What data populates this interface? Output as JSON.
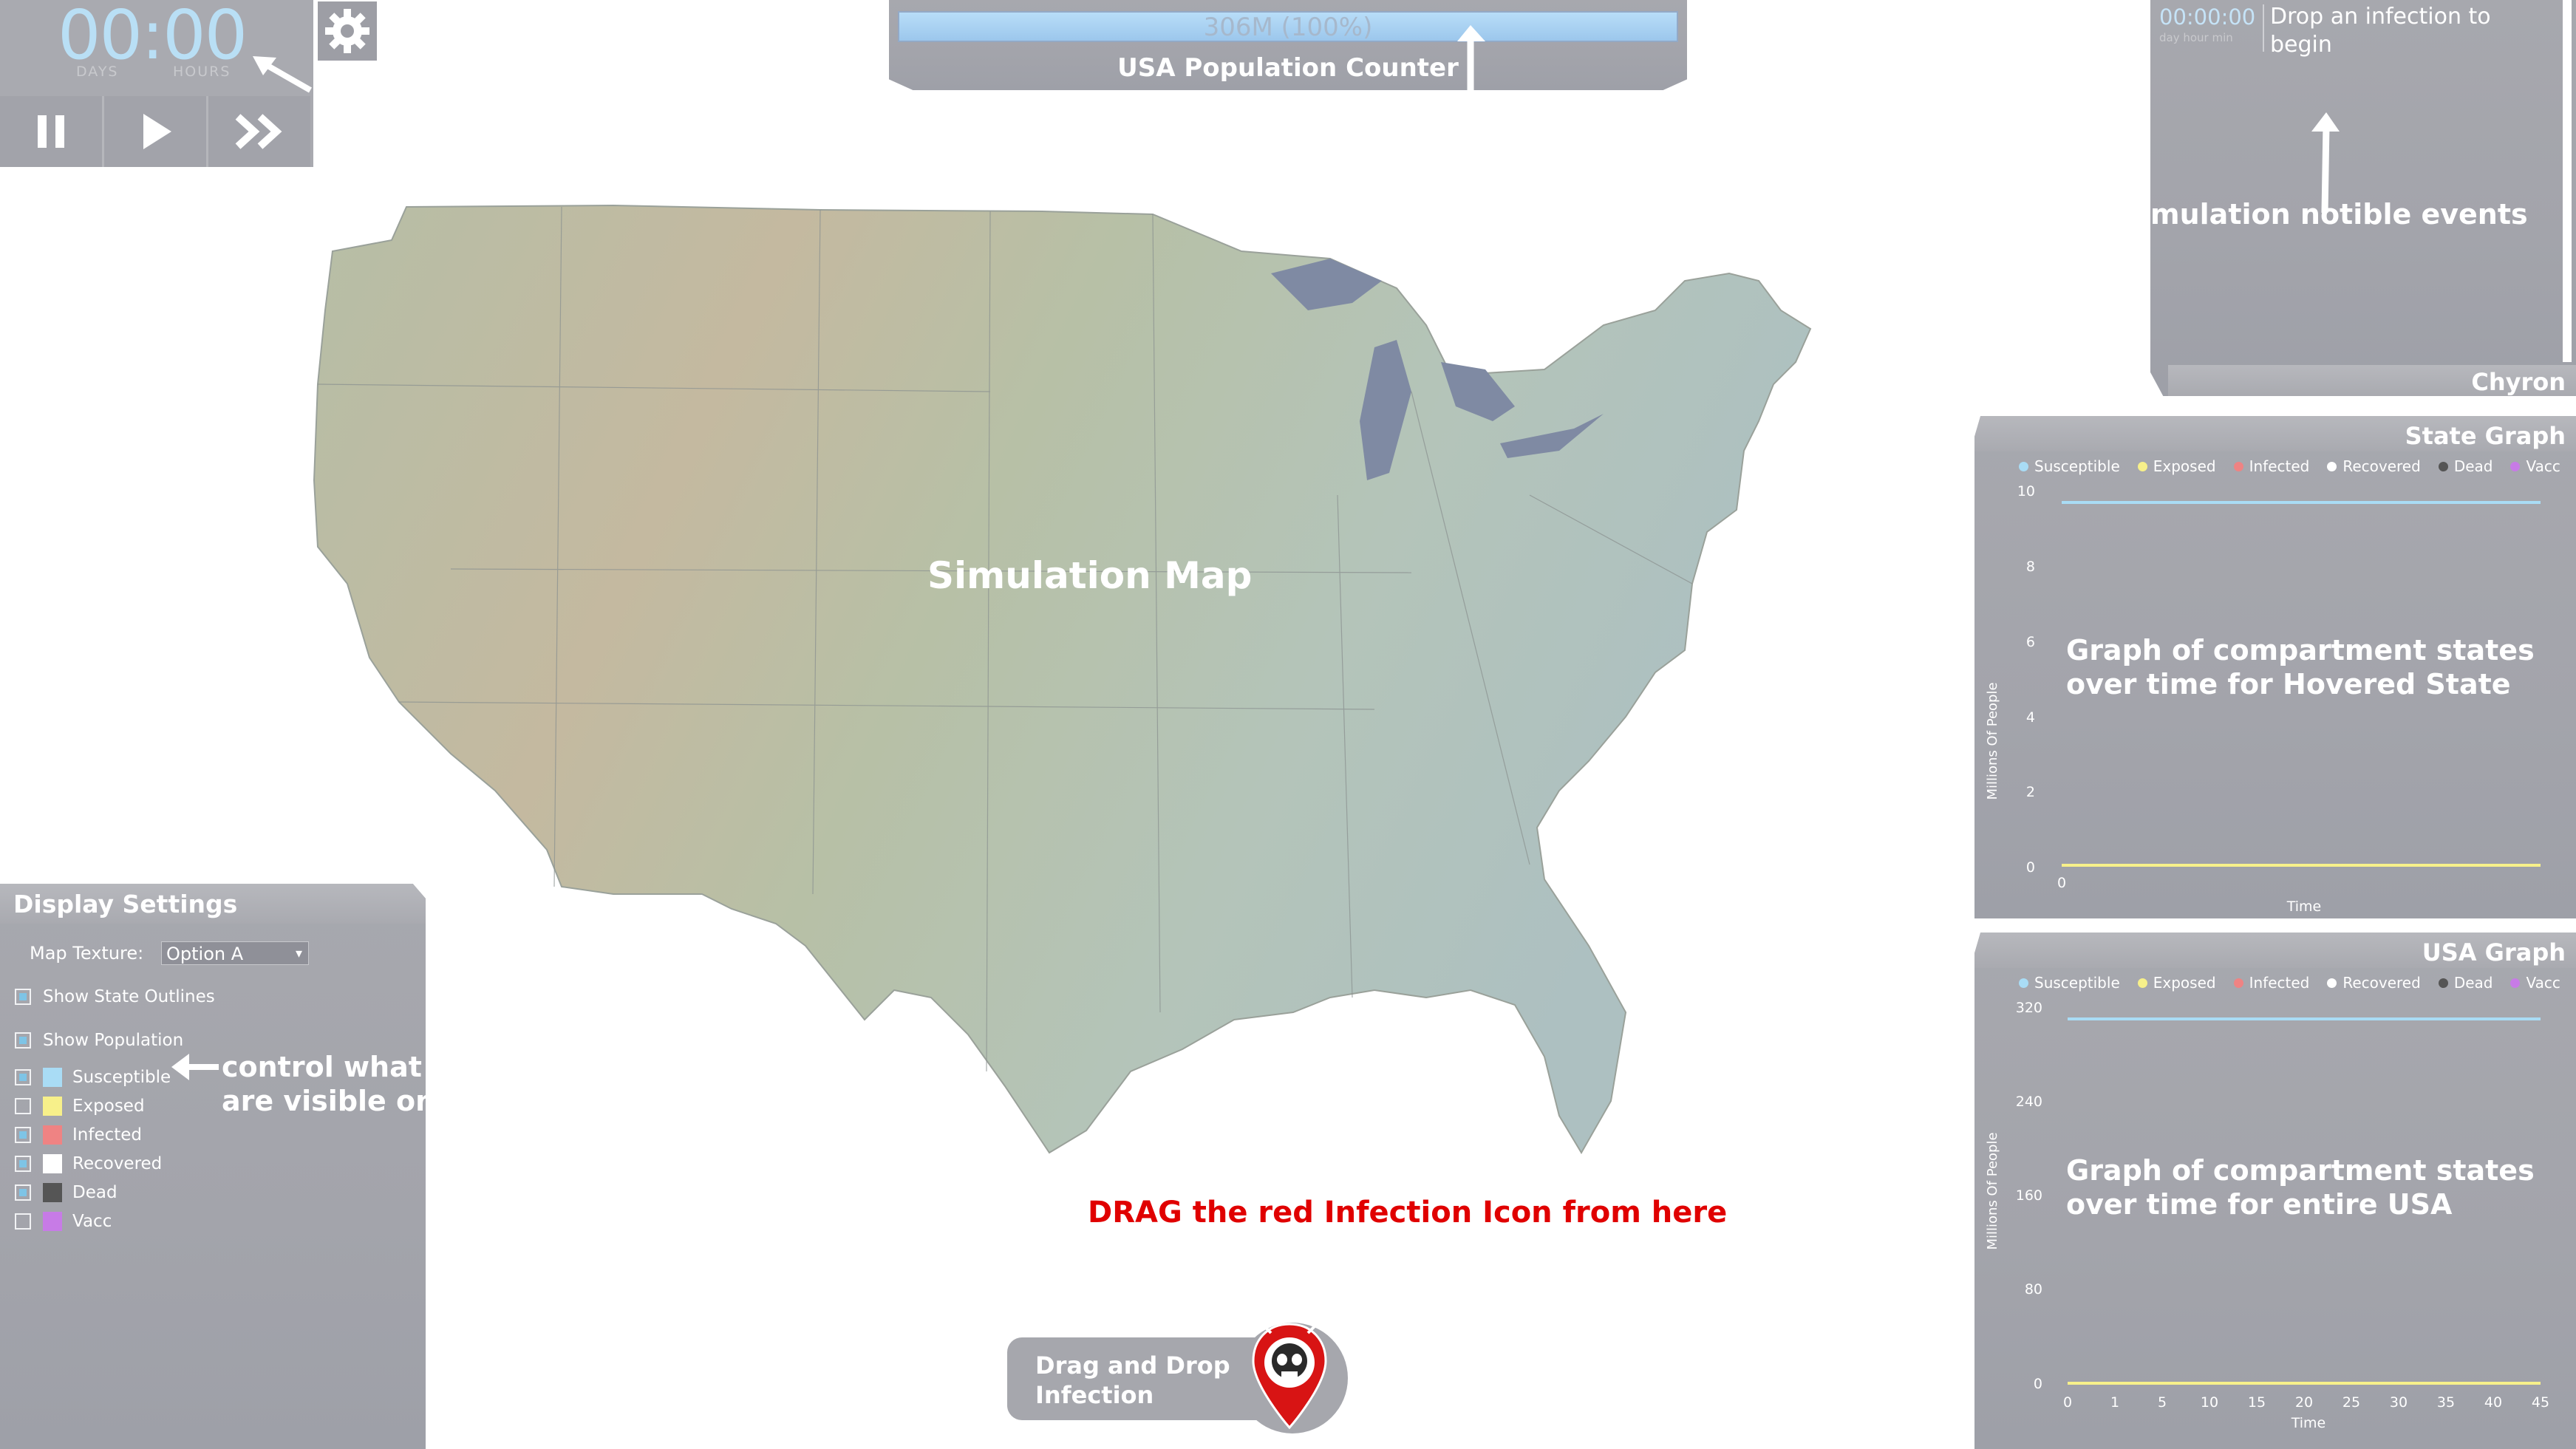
{
  "timer": {
    "value": "00:00",
    "days_label": "DAYS",
    "hours_label": "HOURS"
  },
  "controls": {
    "pause_icon": "pause-icon",
    "play_icon": "play-icon",
    "fast_forward_icon": "fast-forward-icon",
    "settings_icon": "gear-icon"
  },
  "population": {
    "bar_text": "306M (100%)",
    "fraction": 1.0,
    "title": "USA Population Counter"
  },
  "chyron": {
    "time": "00:00:00",
    "time_sub": "day hour min",
    "message": "Drop an infection to begin",
    "title": "Chyron"
  },
  "map": {
    "label": "Simulation Map"
  },
  "state_graph": {
    "title": "State Graph",
    "legend": [
      "Susceptible",
      "Exposed",
      "Infected",
      "Recovered",
      "Dead",
      "Vacc"
    ],
    "ylabel": "Millions Of People",
    "xlabel": "Time",
    "yticks": [
      "10",
      "8",
      "6",
      "4",
      "2",
      "0"
    ],
    "xticks": [
      "0"
    ]
  },
  "usa_graph": {
    "title": "USA Graph",
    "legend": [
      "Susceptible",
      "Exposed",
      "Infected",
      "Recovered",
      "Dead",
      "Vacc"
    ],
    "ylabel": "Millions Of People",
    "xlabel": "Time",
    "yticks": [
      "320",
      "240",
      "160",
      "80",
      "0"
    ],
    "xticks": [
      "0",
      "1",
      "5",
      "10",
      "15",
      "20",
      "25",
      "30",
      "35",
      "40",
      "45"
    ]
  },
  "display_settings": {
    "title": "Display Settings",
    "texture_label": "Map Texture:",
    "texture_value": "Option A",
    "show_outlines": "Show State Outlines",
    "show_population": "Show Population",
    "compartments": [
      {
        "label": "Susceptible",
        "checked": true,
        "color": "#a9dcf5"
      },
      {
        "label": "Exposed",
        "checked": false,
        "color": "#f7f08a"
      },
      {
        "label": "Infected",
        "checked": true,
        "color": "#ef8383"
      },
      {
        "label": "Recovered",
        "checked": true,
        "color": "#ffffff"
      },
      {
        "label": "Dead",
        "checked": true,
        "color": "#555555"
      },
      {
        "label": "Vacc",
        "checked": false,
        "color": "#c77be6"
      }
    ]
  },
  "drag": {
    "label_line1": "Drag and Drop",
    "label_line2": "Infection"
  },
  "annotations": {
    "notable_events": "mulation notible events",
    "control_visible_1": "control what",
    "control_visible_2": "are visible on",
    "state_graph_1": "Graph of compartment states",
    "state_graph_2": "over time for Hovered State",
    "usa_graph_1": "Graph of compartment states",
    "usa_graph_2": "over time for entire USA",
    "drag_hint": "DRAG the red Infection Icon from here"
  },
  "colors": {
    "susceptible": "#a9dcf5",
    "exposed": "#f7f08a",
    "infected": "#ef8383",
    "recovered": "#ffffff",
    "dead": "#555555",
    "vacc": "#c77be6",
    "panel": "#a6a7ad",
    "drag_hint": "#e00000"
  }
}
